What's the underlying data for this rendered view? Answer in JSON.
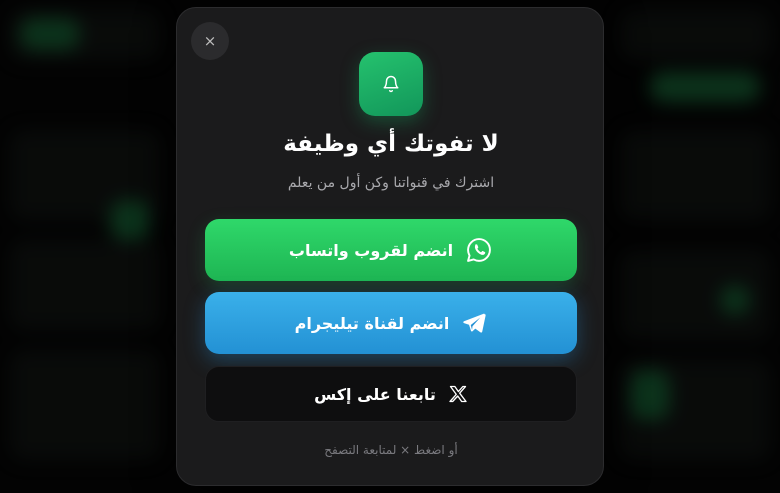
{
  "modal": {
    "close_symbol": "×",
    "title": "لا تفوتك أي وظيفة",
    "subtitle": "اشترك في قنواتنا وكن أول من يعلم",
    "buttons": {
      "whatsapp": "انضم لقروب واتساب",
      "telegram": "انضم لقناة تيليجرام",
      "x": "تابعنا على إكس"
    },
    "hint": "أو اضغط × لمتابعة التصفح"
  },
  "icons": [
    "close-icon",
    "bell-icon",
    "whatsapp-icon",
    "telegram-icon",
    "x-logo-icon"
  ],
  "colors": {
    "whatsapp": "#25d366",
    "telegram": "#2aa3e3",
    "accent_green": "#1faa63",
    "modal_bg": "#1b1b1c"
  }
}
